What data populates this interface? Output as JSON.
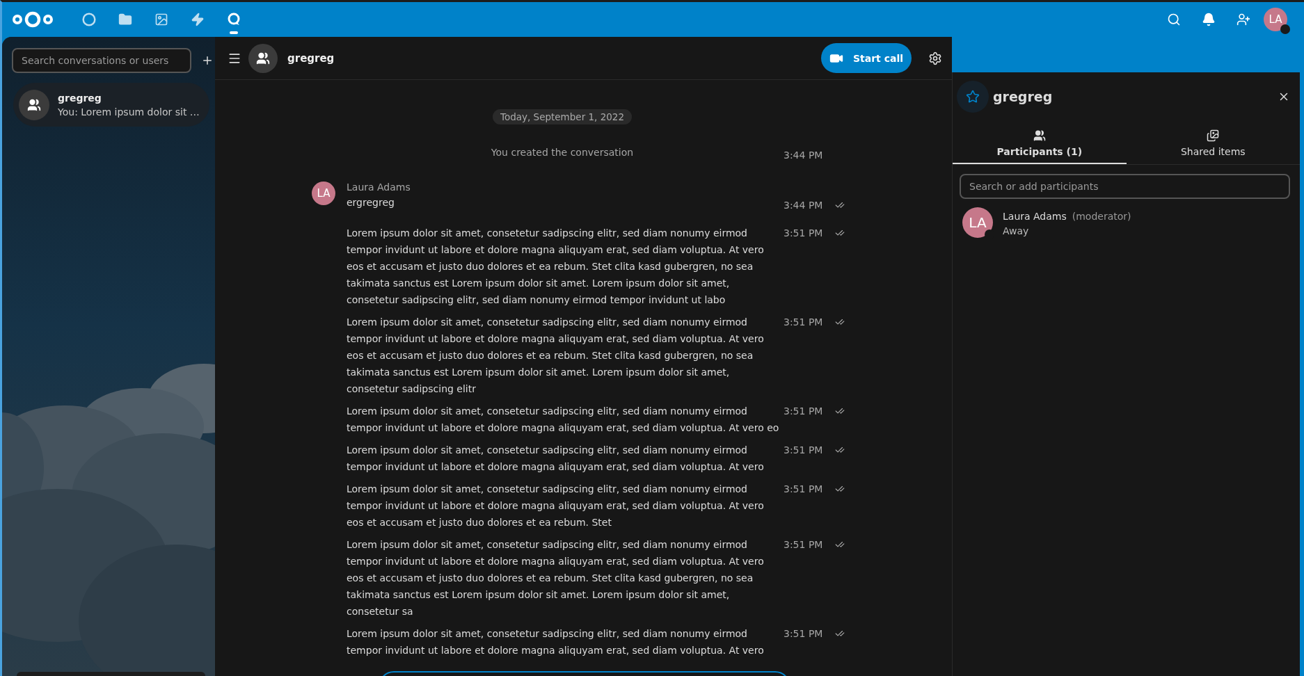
{
  "top_bar": {
    "apps": [
      {
        "kind": "dashboard",
        "selected": false
      },
      {
        "kind": "files",
        "selected": false
      },
      {
        "kind": "photos",
        "selected": false
      },
      {
        "kind": "activity",
        "selected": false
      },
      {
        "kind": "talk",
        "selected": true
      }
    ],
    "user_initials": "LA"
  },
  "sidebar": {
    "search": {
      "placeholder": "Search conversations or users"
    },
    "conversations": [
      {
        "name": "gregreg",
        "preview": "You: Lorem ipsum dolor sit …",
        "selected": true
      }
    ]
  },
  "chat": {
    "title": "gregreg",
    "start_call": "Start call",
    "date": "Today, September 1, 2022",
    "system": {
      "text": "You created the conversation",
      "time": "3:44 PM"
    },
    "author": {
      "name": "Laura Adams",
      "initials": "LA"
    },
    "messages": [
      {
        "lines": [
          "ergregreg"
        ],
        "time": "3:44 PM",
        "read": true
      },
      {
        "lines": [
          "Lorem ipsum dolor sit amet, consetetur sadipscing elitr, sed diam nonumy eirmod",
          "tempor invidunt ut labore et dolore magna aliquyam erat, sed diam voluptua. At vero",
          "eos et accusam et justo duo dolores et ea rebum. Stet clita kasd gubergren, no sea",
          "takimata sanctus est Lorem ipsum dolor sit amet. Lorem ipsum dolor sit amet,",
          "consetetur sadipscing elitr, sed diam nonumy eirmod tempor invidunt ut labo"
        ],
        "time": "3:51 PM",
        "read": true
      },
      {
        "lines": [
          "Lorem ipsum dolor sit amet, consetetur sadipscing elitr, sed diam nonumy eirmod",
          "tempor invidunt ut labore et dolore magna aliquyam erat, sed diam voluptua. At vero",
          "eos et accusam et justo duo dolores et ea rebum. Stet clita kasd gubergren, no sea",
          "takimata sanctus est Lorem ipsum dolor sit amet. Lorem ipsum dolor sit amet,",
          "consetetur sadipscing elitr"
        ],
        "time": "3:51 PM",
        "read": true
      },
      {
        "lines": [
          "Lorem ipsum dolor sit amet, consetetur sadipscing elitr, sed diam nonumy eirmod",
          "tempor invidunt ut labore et dolore magna aliquyam erat, sed diam voluptua. At vero eo"
        ],
        "time": "3:51 PM",
        "read": true
      },
      {
        "lines": [
          "Lorem ipsum dolor sit amet, consetetur sadipscing elitr, sed diam nonumy eirmod",
          "tempor invidunt ut labore et dolore magna aliquyam erat, sed diam voluptua. At vero"
        ],
        "time": "3:51 PM",
        "read": true
      },
      {
        "lines": [
          "Lorem ipsum dolor sit amet, consetetur sadipscing elitr, sed diam nonumy eirmod",
          "tempor invidunt ut labore et dolore magna aliquyam erat, sed diam voluptua. At vero",
          "eos et accusam et justo duo dolores et ea rebum. Stet"
        ],
        "time": "3:51 PM",
        "read": true
      },
      {
        "lines": [
          "Lorem ipsum dolor sit amet, consetetur sadipscing elitr, sed diam nonumy eirmod",
          "tempor invidunt ut labore et dolore magna aliquyam erat, sed diam voluptua. At vero",
          "eos et accusam et justo duo dolores et ea rebum. Stet clita kasd gubergren, no sea",
          "takimata sanctus est Lorem ipsum dolor sit amet. Lorem ipsum dolor sit amet,",
          "consetetur sa"
        ],
        "time": "3:51 PM",
        "read": true
      },
      {
        "lines": [
          "Lorem ipsum dolor sit amet, consetetur sadipscing elitr, sed diam nonumy eirmod",
          "tempor invidunt ut labore et dolore magna aliquyam erat, sed diam voluptua. At vero"
        ],
        "time": "3:51 PM",
        "read": true
      }
    ]
  },
  "details": {
    "title": "gregreg",
    "favorite": false,
    "tabs": [
      {
        "kind": "participants",
        "label": "Participants (1)",
        "selected": true
      },
      {
        "kind": "shared",
        "label": "Shared items",
        "selected": false
      }
    ],
    "search": {
      "placeholder": "Search or add participants"
    },
    "participants": [
      {
        "initials": "LA",
        "name": "Laura Adams",
        "role": "(moderator)",
        "status": "Away"
      }
    ]
  }
}
